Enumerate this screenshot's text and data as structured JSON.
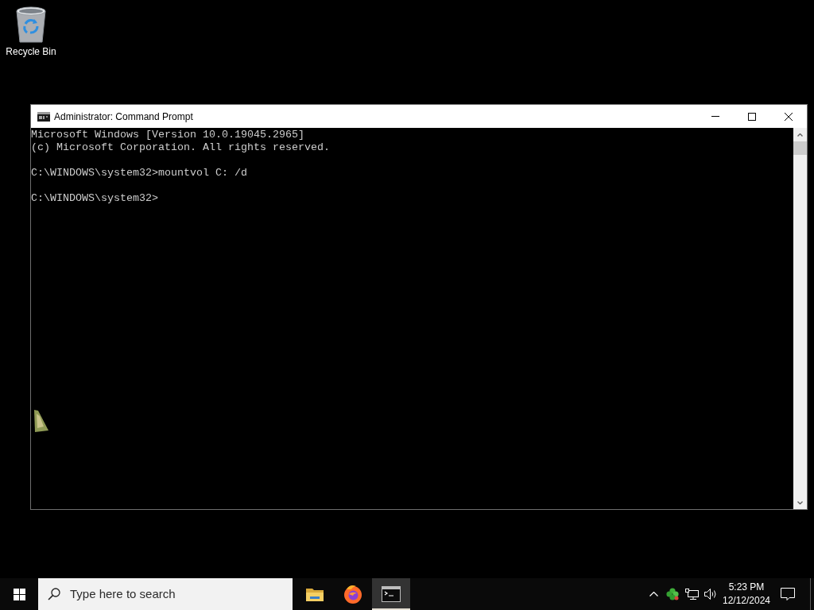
{
  "desktop_icons": [
    {
      "kind": "recycle-bin",
      "label": "Recycle Bin"
    }
  ],
  "window": {
    "title": "Administrator: Command Prompt",
    "console": [
      [
        "Microsoft Windows [Version 10.0.19045.2965]",
        "(c) Microsoft Corporation. All rights reserved."
      ],
      [
        "C:\\WINDOWS\\system32>mountvol C: /d"
      ],
      [
        "C:\\WINDOWS\\system32>"
      ]
    ]
  },
  "taskbar": {
    "search": {
      "placeholder": "Type here to search"
    },
    "apps": [
      {
        "kind": "file-explorer",
        "selected": false
      },
      {
        "kind": "firefox",
        "selected": false
      },
      {
        "kind": "command-prompt",
        "selected": true
      }
    ],
    "clock": {
      "time": "5:23 PM",
      "date": "12/12/2024"
    }
  }
}
